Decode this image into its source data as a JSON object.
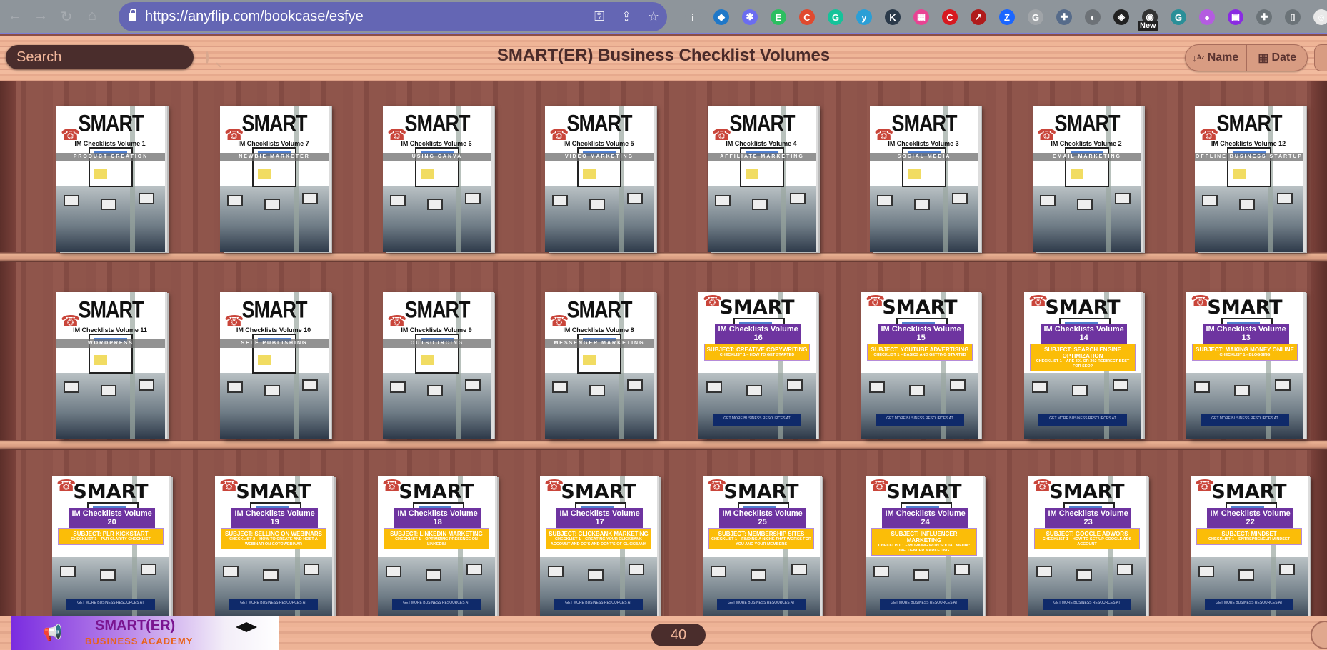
{
  "browser": {
    "url": "https://anyflip.com/bookcase/esfye",
    "nav": [
      {
        "icon": "back-icon",
        "glyph": "←"
      },
      {
        "icon": "forward-icon",
        "glyph": "→"
      },
      {
        "icon": "reload-icon",
        "glyph": "↻"
      },
      {
        "icon": "home-icon",
        "glyph": "⌂"
      }
    ],
    "omnibox_icons": [
      {
        "icon": "key-icon",
        "glyph": "⚿"
      },
      {
        "icon": "share-icon",
        "glyph": "⇪"
      },
      {
        "icon": "bookmark-star-icon",
        "glyph": "☆"
      }
    ],
    "extensions": [
      {
        "icon": "info-extension-icon",
        "glyph": "i",
        "color": "#8e959b"
      },
      {
        "icon": "diamond-extension-icon",
        "glyph": "◆",
        "color": "#1f78c8"
      },
      {
        "icon": "gear-extension-icon",
        "glyph": "✱",
        "color": "#6b6df0"
      },
      {
        "icon": "evernote-extension-icon",
        "glyph": "E",
        "color": "#2dbe60"
      },
      {
        "icon": "c-extension-icon",
        "glyph": "C",
        "color": "#e04a2f"
      },
      {
        "icon": "grammarly-extension-icon",
        "glyph": "G",
        "color": "#15c39a"
      },
      {
        "icon": "y-extension-icon",
        "glyph": "y",
        "color": "#2a9fd6"
      },
      {
        "icon": "k-extension-icon",
        "glyph": "K",
        "color": "#2b3a4a"
      },
      {
        "icon": "palette-extension-icon",
        "glyph": "▦",
        "color": "#e84393"
      },
      {
        "icon": "c-red-extension-icon",
        "glyph": "C",
        "color": "#d71920"
      },
      {
        "icon": "arrow-extension-icon",
        "glyph": "↗",
        "color": "#b01b1b"
      },
      {
        "icon": "z-extension-icon",
        "glyph": "Z",
        "color": "#1a66ff"
      },
      {
        "icon": "google-extension-icon",
        "glyph": "G",
        "color": "#a0a4a8"
      },
      {
        "icon": "puzzle-box-extension-icon",
        "glyph": "✚",
        "color": "#566b8a"
      },
      {
        "icon": "circle-extension-icon",
        "glyph": "◐",
        "color": "#6d7277"
      },
      {
        "icon": "drop-extension-icon",
        "glyph": "◈",
        "color": "#222"
      },
      {
        "icon": "rainbow-extension-icon",
        "glyph": "◉",
        "color": "#333"
      },
      {
        "icon": "g-teal-extension-icon",
        "glyph": "G",
        "color": "#2a8f98"
      },
      {
        "icon": "gradient-extension-icon",
        "glyph": "●",
        "color": "#b45ce0"
      },
      {
        "icon": "chat-extension-icon",
        "glyph": "▣",
        "color": "#8a2be2"
      },
      {
        "icon": "extensions-puzzle-icon",
        "glyph": "✚",
        "color": "#6b7378"
      },
      {
        "icon": "sidepanel-icon",
        "glyph": "▯",
        "color": "#6b7378"
      },
      {
        "icon": "profile-avatar-icon",
        "glyph": "☺",
        "color": "#e8e8e8"
      }
    ],
    "new_badge": "New"
  },
  "header": {
    "search_placeholder": "Search",
    "title": "SMART(ER) Business Checklist Volumes",
    "sort_name": "Name",
    "sort_date": "Date"
  },
  "books": [
    {
      "style": "classic",
      "volume": "IM Checklists Volume 1",
      "topic": "PRODUCT CREATION"
    },
    {
      "style": "classic",
      "volume": "IM Checklists Volume 7",
      "topic": "NEWBIE MARKETER"
    },
    {
      "style": "classic",
      "volume": "IM Checklists Volume 6",
      "topic": "USING CANVA"
    },
    {
      "style": "classic",
      "volume": "IM Checklists Volume 5",
      "topic": "VIDEO MARKETING"
    },
    {
      "style": "classic",
      "volume": "IM Checklists Volume 4",
      "topic": "AFFILIATE MARKETING"
    },
    {
      "style": "classic",
      "volume": "IM Checklists Volume 3",
      "topic": "SOCIAL MEDIA"
    },
    {
      "style": "classic",
      "volume": "IM Checklists Volume 2",
      "topic": "EMAIL MARKETING"
    },
    {
      "style": "classic",
      "volume": "IM Checklists Volume 12",
      "topic": "OFFLINE BUSINESS STARTUP"
    },
    {
      "style": "classic",
      "volume": "IM Checklists Volume 11",
      "topic": "WORDPRESS"
    },
    {
      "style": "classic",
      "volume": "IM Checklists Volume 10",
      "topic": "SELF PUBLISHING"
    },
    {
      "style": "classic",
      "volume": "IM Checklists Volume 9",
      "topic": "OUTSOURCING"
    },
    {
      "style": "classic",
      "volume": "IM Checklists Volume 8",
      "topic": "MESSENGER MARKETING"
    },
    {
      "style": "modern",
      "volume": "IM Checklists Volume 16",
      "subject": "SUBJECT: CREATIVE COPYWRITING",
      "checklist": "CHECKLIST 1 – HOW TO GET STARTED",
      "footer": "GET MORE BUSINESS RESOURCES AT"
    },
    {
      "style": "modern",
      "volume": "IM Checklists Volume 15",
      "subject": "SUBJECT: YOUTUBE ADVERTISING",
      "checklist": "CHECKLIST 1 – BASICS AND GETTING STARTED",
      "footer": "GET MORE BUSINESS RESOURCES AT"
    },
    {
      "style": "modern",
      "volume": "IM Checklists Volume 14",
      "subject": "SUBJECT: SEARCH ENGINE OPTIMIZATION",
      "checklist": "CHECKLIST 1 – ARE 301 OR 302 REDIRECT BEST FOR SEO?",
      "footer": "GET MORE BUSINESS RESOURCES AT"
    },
    {
      "style": "modern",
      "volume": "IM Checklists Volume 13",
      "subject": "SUBJECT: MAKING MONEY ONLINE",
      "checklist": "CHECKLIST 1 - BLOGGING",
      "footer": "GET MORE BUSINESS RESOURCES AT"
    },
    {
      "style": "modern",
      "volume": "IM Checklists Volume 20",
      "subject": "SUBJECT: PLR KICKSTART",
      "checklist": "CHECKLIST 1 – PLR CLARITY CHECKLIST",
      "footer": "GET MORE BUSINESS RESOURCES AT"
    },
    {
      "style": "modern",
      "volume": "IM Checklists Volume 19",
      "subject": "SUBJECT: SELLING ON WEBINARS",
      "checklist": "CHECKLIST 2 – HOW TO CREATE AND HOST A WEBINAR ON GOTOWEBINAR",
      "footer": "GET MORE BUSINESS RESOURCES AT"
    },
    {
      "style": "modern",
      "volume": "IM Checklists Volume 18",
      "subject": "SUBJECT: LINKEDIN MARKETING",
      "checklist": "CHECKLIST 1 – OPTIMIZING PRESENCE ON LINKEDIN",
      "footer": "GET MORE BUSINESS RESOURCES AT"
    },
    {
      "style": "modern",
      "volume": "IM Checklists Volume 17",
      "subject": "SUBJECT: CLICKBANK MARKETING",
      "checklist": "CHECKLIST 1 – CREATING YOUR CLICKBANK ACCOUNT AND DO'S AND DONT'S OF CLICKBANK",
      "footer": "GET MORE BUSINESS RESOURCES AT"
    },
    {
      "style": "modern",
      "volume": "IM Checklists Volume 25",
      "subject": "SUBJECT: MEMBERSHIP SITES",
      "checklist": "CHECKLIST 1 – FINDING A NICHE THAT WORKS FOR YOU AND YOUR MEMBERS",
      "footer": "GET MORE BUSINESS RESOURCES AT"
    },
    {
      "style": "modern",
      "volume": "IM Checklists Volume 24",
      "subject": "SUBJECT: INFLUENCER MARKETING",
      "checklist": "CHECKLIST 1 – WORKING WITH SOCIAL MEDIA: INFLUENCER MARKETING",
      "footer": "GET MORE BUSINESS RESOURCES AT"
    },
    {
      "style": "modern",
      "volume": "IM Checklists Volume 23",
      "subject": "SUBJECT: GOOGLE ADWORS",
      "checklist": "CHECKLIST 1 – HOW TO SET UP GOOGLE ADS ACCOUNT",
      "footer": "GET MORE BUSINESS RESOURCES AT"
    },
    {
      "style": "modern",
      "volume": "IM Checklists Volume 22",
      "subject": "SUBJECT: MINDSET",
      "checklist": "CHECKLIST 1 – ENTREPRENEUR MINDSET",
      "footer": "GET MORE BUSINESS RESOURCES AT"
    }
  ],
  "cover_brand": "SMART",
  "footer": {
    "logo_line1": "SMART(ER)",
    "logo_line2": "BUSINESS ACADEMY",
    "page_count": "40"
  },
  "colors": {
    "omnibox": "#6466b4",
    "header_wood": "#f2bb9e",
    "shelf_wood": "#8d534a",
    "search_bg": "#4a2d2c",
    "volume_label": "#6e34a0",
    "subject_box": "#fbbd08"
  }
}
